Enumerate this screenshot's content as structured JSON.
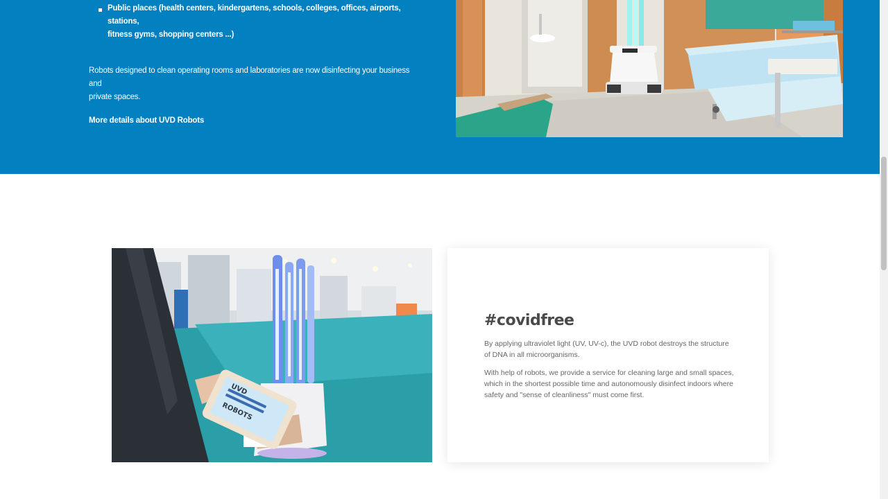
{
  "top_section": {
    "bullets": [
      {
        "line1": "Public places (health centers, kindergartens, schools, colleges, offices, airports, stations,",
        "line2": "fitness gyms, shopping centers ...)"
      }
    ],
    "paragraph_line1": "Robots designed to clean operating rooms and laboratories are now disinfecting your business and",
    "paragraph_line2": "private spaces.",
    "more_link": "More details about UVD Robots",
    "background_color": "#0380c0"
  },
  "images": {
    "hospital_image": "uvd-robot-hospital-room",
    "exhibition_image": "uvd-robot-tablet-exhibition",
    "tablet_logo_line1": "UVD",
    "tablet_logo_line2": "ROBOTS"
  },
  "card": {
    "title": "#covidfree",
    "paragraphs": [
      "By applying ultraviolet light (UV, UV-c), the UVD robot destroys the structure of DNA in all microorganisms.",
      "With help of robots, we provide a service for cleaning large and small spaces, which in the shortest possible time and autonomously disinfect indoors where safety and \"sense of cleanliness\" must come first."
    ]
  },
  "scrollbar": {
    "position": 0.31
  }
}
